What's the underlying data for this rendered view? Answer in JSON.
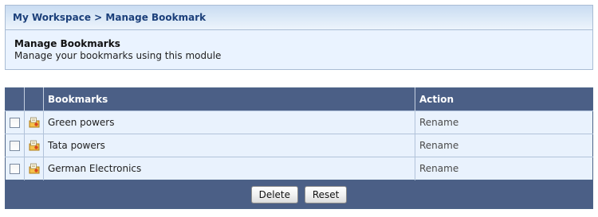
{
  "breadcrumb": {
    "workspace": "My Workspace",
    "separator": ">",
    "current": "Manage Bookmark"
  },
  "header": {
    "title": "Manage Bookmarks",
    "description": "Manage your bookmarks using this module"
  },
  "table": {
    "columns": {
      "bookmarks": "Bookmarks",
      "action": "Action"
    },
    "rows": [
      {
        "name": "Green powers",
        "action": "Rename",
        "checked": false
      },
      {
        "name": "Tata powers",
        "action": "Rename",
        "checked": false
      },
      {
        "name": "German Electronics",
        "action": "Rename",
        "checked": false
      }
    ]
  },
  "buttons": {
    "delete": "Delete",
    "reset": "Reset"
  },
  "icons": {
    "row_icon": "bookmark-icon"
  }
}
